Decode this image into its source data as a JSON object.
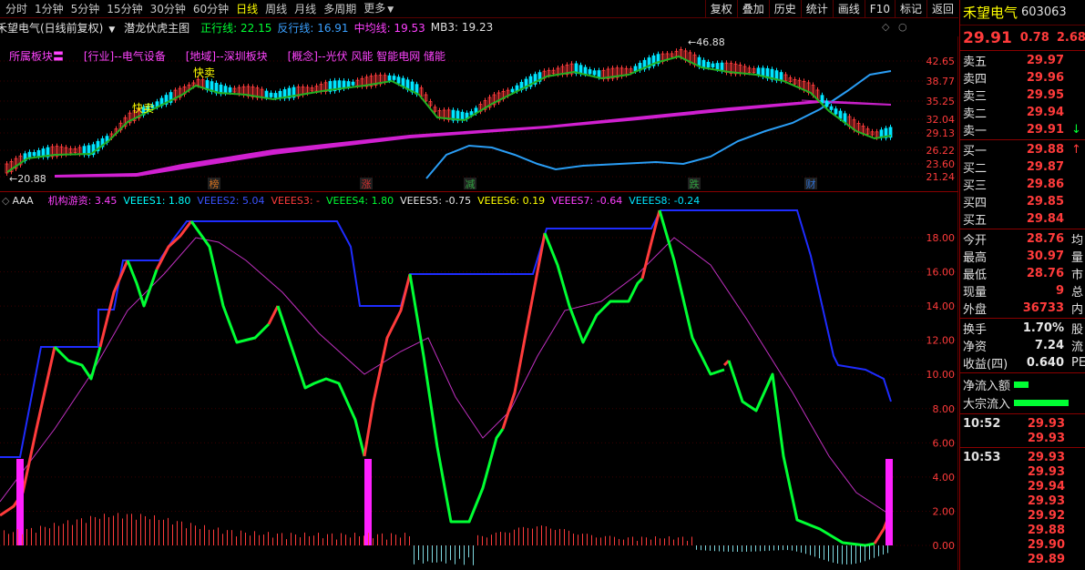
{
  "toolbar": {
    "periods": [
      "分时",
      "1分钟",
      "5分钟",
      "15分钟",
      "30分钟",
      "60分钟",
      "日线",
      "周线",
      "月线",
      "多周期",
      "更多"
    ],
    "active_index": 6,
    "buttons": [
      "复权",
      "叠加",
      "历史",
      "统计",
      "画线",
      "F10",
      "标记",
      "返回"
    ]
  },
  "info": {
    "title": "禾望电气(日线前复权)",
    "indicator": "潜龙伏虎主图",
    "zhengxing": "正行线: 22.15",
    "fanxing": "反行线: 16.91",
    "zhongjun": "中均线: 19.53",
    "mb3": "MB3: 19.23"
  },
  "sectors": [
    "所属板块〓",
    "[行业]--电气设备",
    "[地域]--深圳板块",
    "[概念]--光伏 风能 智能电网 储能"
  ],
  "main_chart": {
    "price_labels": [
      "42.65",
      "38.77",
      "35.25",
      "32.04",
      "29.13",
      "26.22",
      "23.60",
      "21.24"
    ],
    "high_label": "46.88",
    "low_label": "20.88",
    "buy_labels": [
      "快卖",
      "快卖"
    ],
    "markers": [
      "榜",
      "涨",
      "减",
      "跌",
      "财"
    ]
  },
  "sub_info": {
    "name": "AAA",
    "jigou": "机构游资: 3.45",
    "v1": "VEEES1: 1.80",
    "v2": "VEEES2: 5.04",
    "v3": "VEEES3: -",
    "v4": "VEEES4: 1.80",
    "v5": "VEEES5: -0.75",
    "v6": "VEEES6: 0.19",
    "v7": "VEEES7: -0.64",
    "v8": "VEEES8: -0.24"
  },
  "sub_chart": {
    "y_labels": [
      "18.00",
      "16.00",
      "14.00",
      "12.00",
      "10.00",
      "8.00",
      "6.00",
      "4.00",
      "2.00",
      "0.00"
    ]
  },
  "quote": {
    "name": "禾望电气",
    "code": "603063",
    "price": "29.91",
    "change": "0.78",
    "change_pct": "2.68%",
    "asks": [
      {
        "label": "卖五",
        "price": "29.97"
      },
      {
        "label": "卖四",
        "price": "29.96"
      },
      {
        "label": "卖三",
        "price": "29.95"
      },
      {
        "label": "卖二",
        "price": "29.94"
      },
      {
        "label": "卖一",
        "price": "29.91"
      }
    ],
    "bids": [
      {
        "label": "买一",
        "price": "29.88"
      },
      {
        "label": "买二",
        "price": "29.87"
      },
      {
        "label": "买三",
        "price": "29.86"
      },
      {
        "label": "买四",
        "price": "29.85"
      },
      {
        "label": "买五",
        "price": "29.84"
      }
    ],
    "stats1": [
      {
        "label": "今开",
        "value": "28.76",
        "extra": "均"
      },
      {
        "label": "最高",
        "value": "30.97",
        "extra": "量"
      },
      {
        "label": "最低",
        "value": "28.76",
        "extra": "市"
      },
      {
        "label": "现量",
        "value": "9",
        "extra": "总"
      },
      {
        "label": "外盘",
        "value": "36733",
        "extra": "内"
      }
    ],
    "stats2": [
      {
        "label": "换手",
        "value": "1.70%",
        "extra": "股"
      },
      {
        "label": "净资",
        "value": "7.24",
        "extra": "流"
      },
      {
        "label": "收益(四)",
        "value": "0.640",
        "extra": "PE"
      }
    ],
    "flows": [
      "净流入额",
      "大宗流入"
    ],
    "ticks": [
      {
        "time": "10:52",
        "price": "29.93"
      },
      {
        "time": "",
        "price": "29.93"
      },
      {
        "time": "10:53",
        "price": "29.93"
      },
      {
        "time": "",
        "price": "29.93"
      },
      {
        "time": "",
        "price": "29.94"
      },
      {
        "time": "",
        "price": "29.93"
      },
      {
        "time": "",
        "price": "29.92"
      },
      {
        "time": "",
        "price": "29.88"
      },
      {
        "time": "",
        "price": "29.90"
      },
      {
        "time": "",
        "price": "29.89"
      }
    ]
  },
  "colors": {
    "up": "#ff3b3b",
    "down": "#00e5ff",
    "green": "#00ff33",
    "blue": "#1e2cff",
    "magenta": "#d020d0",
    "yellow": "#ffff00"
  }
}
